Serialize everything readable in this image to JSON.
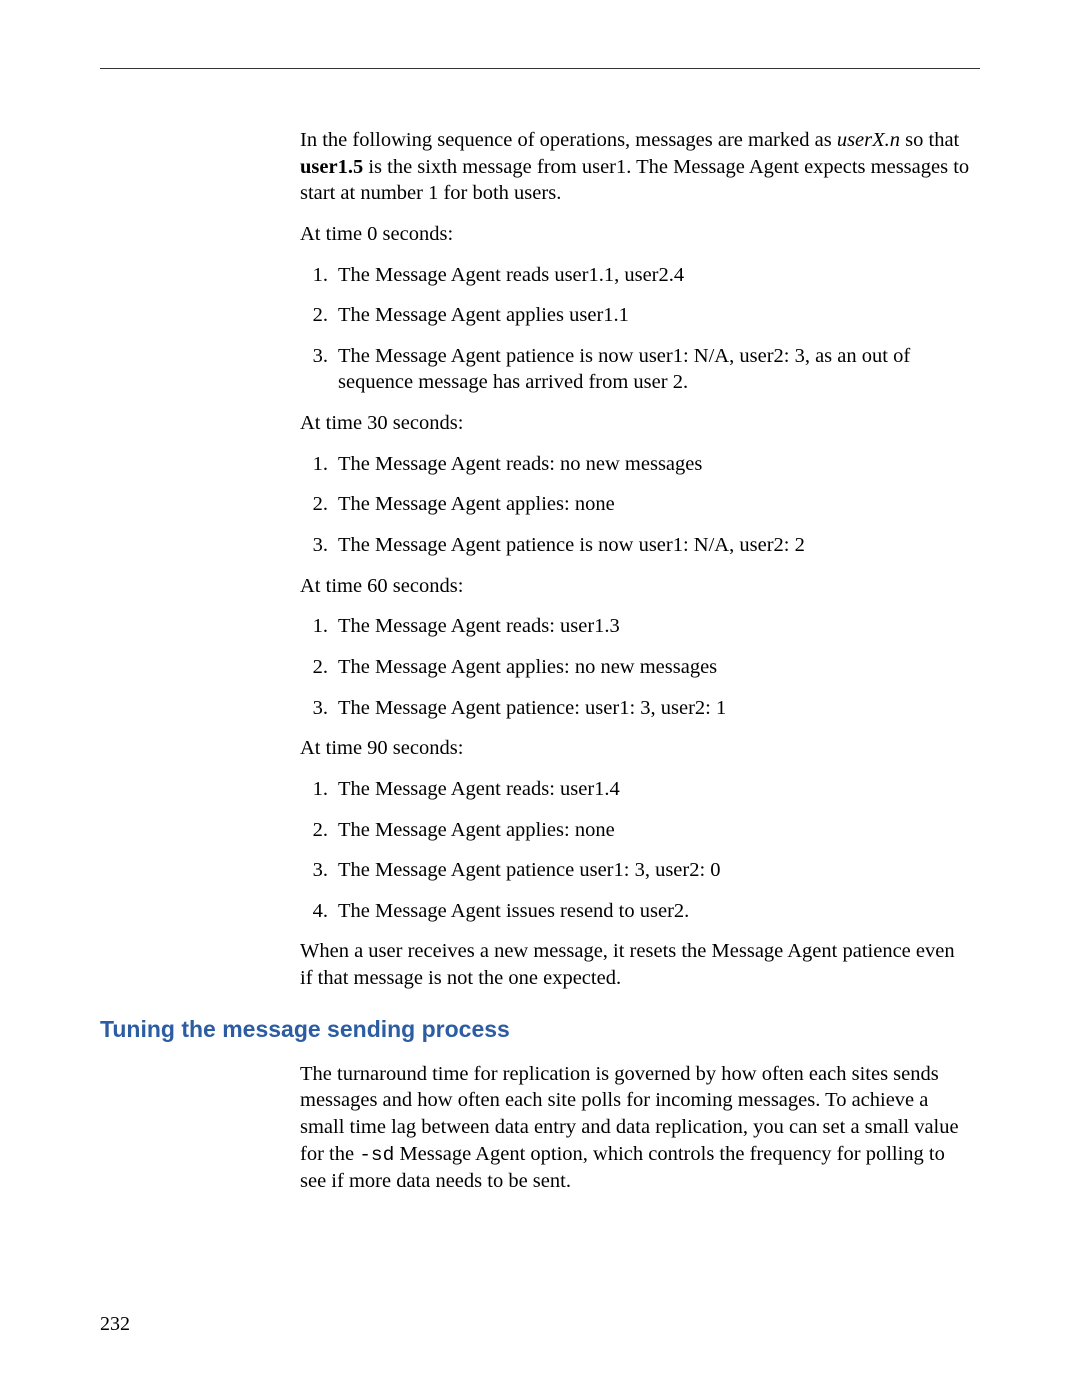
{
  "intro": {
    "pre": "In the following sequence of operations, messages are marked as ",
    "userx": "userX.n",
    "mid": " so that ",
    "bold": "user1.5",
    "post": " is the sixth message from user1. The Message Agent expects messages to start at number 1 for both users."
  },
  "sections": {
    "t0": {
      "label": "At time 0 seconds:",
      "items": [
        "The Message Agent reads user1.1, user2.4",
        "The Message Agent applies user1.1",
        "The Message Agent patience is now user1: N/A, user2: 3, as an out of sequence message has arrived from user 2."
      ]
    },
    "t30": {
      "label": "At time 30 seconds:",
      "items": [
        "The Message Agent reads: no new messages",
        "The Message Agent applies: none",
        "The Message Agent patience is now user1: N/A, user2: 2"
      ]
    },
    "t60": {
      "label": "At time 60 seconds:",
      "items": [
        "The Message Agent reads: user1.3",
        "The Message Agent applies: no new messages",
        "The Message Agent patience: user1: 3, user2: 1"
      ]
    },
    "t90": {
      "label": "At time 90 seconds:",
      "items": [
        "The Message Agent reads: user1.4",
        "The Message Agent applies: none",
        "The Message Agent patience user1: 3, user2: 0",
        "The Message Agent issues resend to user2."
      ]
    }
  },
  "closing": "When a user receives a new message, it resets the Message Agent patience even if that message is not the one expected.",
  "heading": "Tuning the message sending process",
  "tuning_para": {
    "pre": "The turnaround time for replication is governed by how often each sites sends messages and how often each site polls for incoming messages. To achieve a small time lag between data entry and data replication, you can set a small value for the ",
    "code": "-sd",
    "post": " Message Agent option, which controls the frequency for polling to see if more data needs to be sent."
  },
  "page_number": "232",
  "numbers": {
    "n1": "1.",
    "n2": "2.",
    "n3": "3.",
    "n4": "4."
  }
}
